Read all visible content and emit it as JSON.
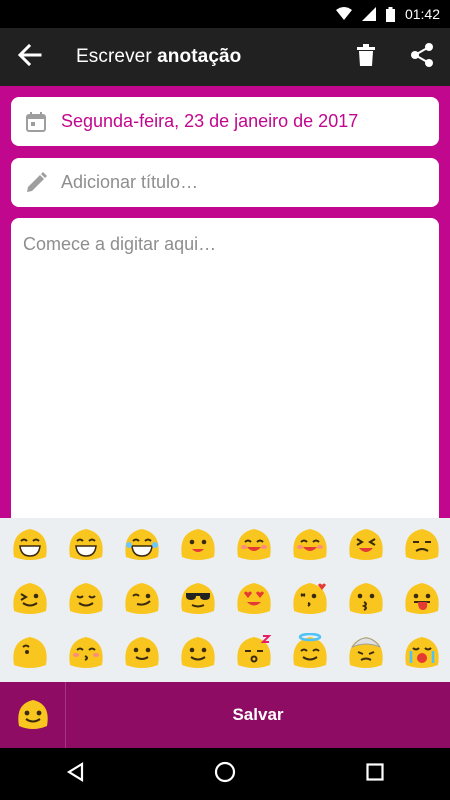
{
  "status_bar": {
    "time": "01:42"
  },
  "toolbar": {
    "title_prefix": "Escrever ",
    "title_bold": "anotação",
    "icons": [
      "back-arrow-icon",
      "delete-icon",
      "share-icon"
    ]
  },
  "form": {
    "date": "Segunda-feira, 23 de janeiro de 2017",
    "title_placeholder": "Adicionar título…",
    "body_placeholder": "Comece a digitar aqui…"
  },
  "emoji_keyboard": {
    "rows": [
      [
        "grinning",
        "grinning-teeth",
        "laughing-tears",
        "smiling",
        "happy-blush",
        "smile-closed-eyes",
        "squinting-laugh",
        "confused"
      ],
      [
        "winking-tongue",
        "relieved",
        "smirk-wink",
        "cool-sunglasses",
        "heart-eyes",
        "kissing-heart",
        "kissing",
        "tongue-out"
      ],
      [
        "partial-face",
        "blushing-kiss",
        "slight-smile",
        "neutral-smile",
        "sleeping",
        "angel",
        "turban-face",
        "crying-loud"
      ]
    ]
  },
  "bottom_bar": {
    "save_label": "Salvar"
  },
  "colors": {
    "accent": "#c2078f",
    "toolbar": "#212121",
    "bottom": "#8e0c63",
    "emoji_yellow": "#f9c51f"
  }
}
